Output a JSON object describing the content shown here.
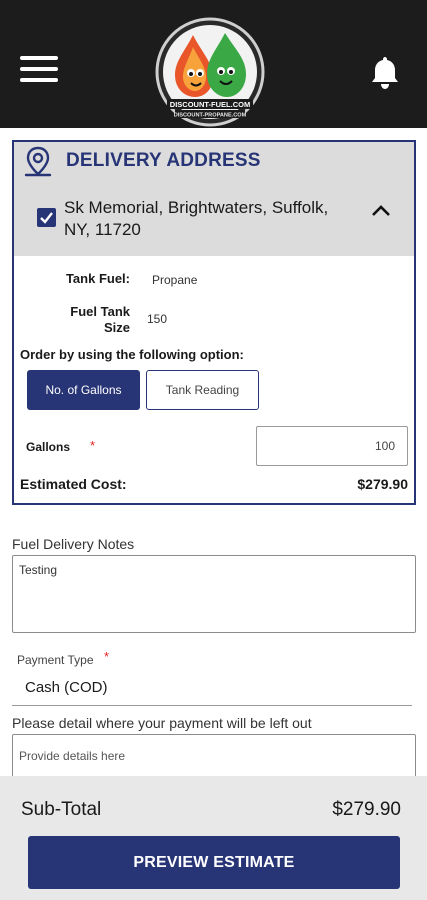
{
  "header": {
    "menu_icon": "hamburger-menu-icon",
    "notification_icon": "bell-icon",
    "logo": {
      "line1": "DISCOUNT-FUEL.COM",
      "line2": "DISCOUNT-PROPANE.COM",
      "colors": {
        "left_drop": "#e8562a",
        "right_drop": "#3aa845",
        "ring": "#d0d0d0"
      }
    }
  },
  "delivery": {
    "title": "DELIVERY ADDRESS",
    "location_icon": "map-pin-icon",
    "address_line1": "Sk Memorial, Brightwaters, Suffolk,",
    "address_line2": "NY, 11720",
    "address_checked": true,
    "collapse_icon": "chevron-up-icon",
    "tank_fuel_label": "Tank Fuel:",
    "tank_fuel_value": "Propane",
    "tank_size_label_line1": "Fuel Tank",
    "tank_size_label_line2": "Size",
    "tank_size_value": "150",
    "order_option_label": "Order by using the following option:",
    "option_gallons": "No. of Gallons",
    "option_tank_reading": "Tank Reading",
    "selected_option": "No. of Gallons",
    "gallons_label": "Gallons",
    "required_mark": "*",
    "gallons_value": "100",
    "estimated_cost_label": "Estimated Cost:",
    "estimated_cost_value": "$279.90"
  },
  "notes": {
    "label": "Fuel Delivery Notes",
    "value": "Testing"
  },
  "payment": {
    "label": "Payment Type",
    "required_mark": "*",
    "value": "Cash (COD)",
    "detail_label": "Please detail where your payment will be left out",
    "detail_placeholder": "Provide details here"
  },
  "footer": {
    "subtotal_label": "Sub-Total",
    "subtotal_value": "$279.90",
    "preview_button": "PREVIEW ESTIMATE"
  },
  "colors": {
    "brand_navy": "#273576",
    "header_bg": "#1c1c1c",
    "card_head_bg": "#dcdcdc",
    "footer_bg": "#e8e8e8",
    "required_red": "#e02424"
  }
}
